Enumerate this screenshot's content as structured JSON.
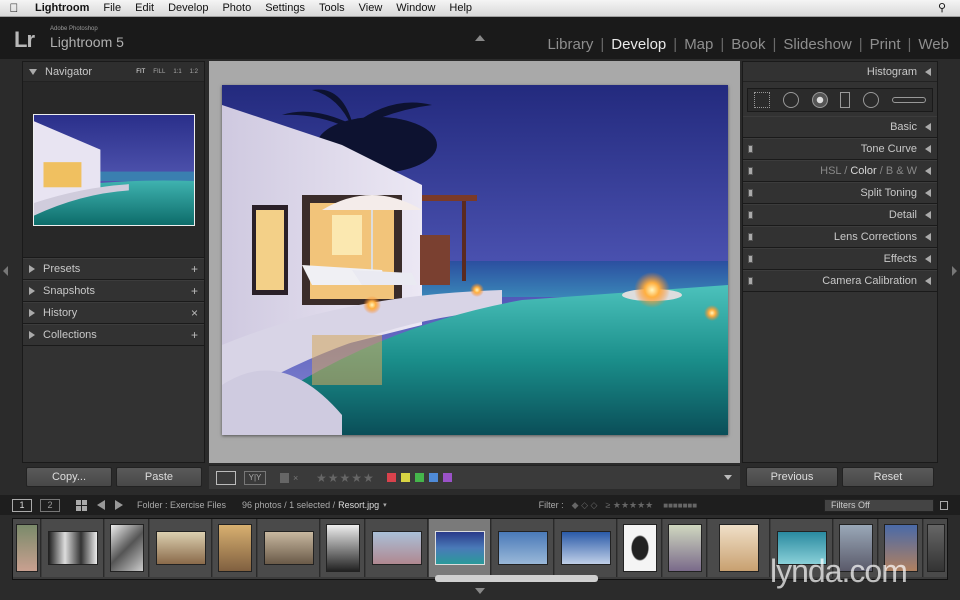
{
  "menubar": {
    "app_name": "Lightroom",
    "items": [
      "File",
      "Edit",
      "Develop",
      "Photo",
      "Settings",
      "Tools",
      "View",
      "Window",
      "Help"
    ]
  },
  "identity": {
    "logo": "Lr",
    "vendor": "Adobe Photoshop",
    "product": "Lightroom 5"
  },
  "modules": [
    "Library",
    "Develop",
    "Map",
    "Book",
    "Slideshow",
    "Print",
    "Web"
  ],
  "active_module": "Develop",
  "left_panel": {
    "navigator": {
      "title": "Navigator",
      "zoom": [
        "FIT",
        "FILL",
        "1:1",
        "1:2"
      ],
      "selected_zoom": "FIT"
    },
    "sections": [
      {
        "label": "Presets",
        "action": "+"
      },
      {
        "label": "Snapshots",
        "action": "+"
      },
      {
        "label": "History",
        "action": "×"
      },
      {
        "label": "Collections",
        "action": "+"
      }
    ],
    "copy_label": "Copy...",
    "paste_label": "Paste"
  },
  "right_panel": {
    "histogram_title": "Histogram",
    "sections": [
      "Basic",
      "Tone Curve",
      "Split Toning",
      "Detail",
      "Lens Corrections",
      "Effects",
      "Camera Calibration"
    ],
    "hsl": {
      "a": "HSL",
      "b": "Color",
      "c": "B & W",
      "sep": "/"
    },
    "previous_label": "Previous",
    "reset_label": "Reset"
  },
  "filmstrip_header": {
    "screen1": "1",
    "screen2": "2",
    "folder": "Folder : Exercise Files",
    "count": "96 photos / 1 selected /",
    "filename": "Resort.jpg",
    "filter_label": "Filter :",
    "filter_state": "Filters Off"
  },
  "label_colors": [
    "#d9424c",
    "#d8d443",
    "#45b54b",
    "#4f8bd8",
    "#9a52c8"
  ],
  "watermark": "lynda.com"
}
